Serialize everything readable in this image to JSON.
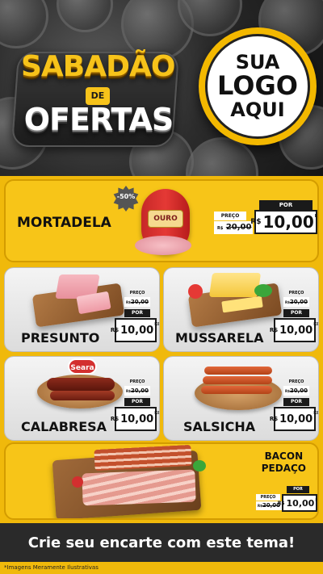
{
  "header": {
    "title_line1": "SABADÃO",
    "title_de": "DE",
    "title_line2": "OFERTAS",
    "logo": {
      "line1": "SUA",
      "line2": "LOGO",
      "line3": "AQUI"
    }
  },
  "labels": {
    "por": "POR",
    "preco": "PREÇO",
    "currency": "R$",
    "unit": "KG"
  },
  "products": {
    "mortadela": {
      "name": "MORTADELA",
      "discount": "-50%",
      "brand": "OURO",
      "old_price": "20,00",
      "new_price": "10,00"
    },
    "presunto": {
      "name": "PRESUNTO",
      "old_price": "20,00",
      "new_price": "10,00"
    },
    "mussarela": {
      "name": "MUSSARELA",
      "old_price": "20,00",
      "new_price": "10,00"
    },
    "calabresa": {
      "name": "CALABRESA",
      "brand": "Seara",
      "old_price": "20,00",
      "new_price": "10,00"
    },
    "salsicha": {
      "name": "SALSICHA",
      "old_price": "20,00",
      "new_price": "10,00"
    },
    "bacon": {
      "name_line1": "BACON",
      "name_line2": "PEDAÇO",
      "old_price": "20,00",
      "new_price": "10,00"
    }
  },
  "footer": {
    "cta": "Crie seu encarte com este tema!",
    "disclaimer": "*Imagens Meramente Ilustrativas"
  },
  "colors": {
    "yellow": "#f0b90b",
    "dark": "#1a1a1a",
    "card_gray": "#e6e6e6"
  }
}
